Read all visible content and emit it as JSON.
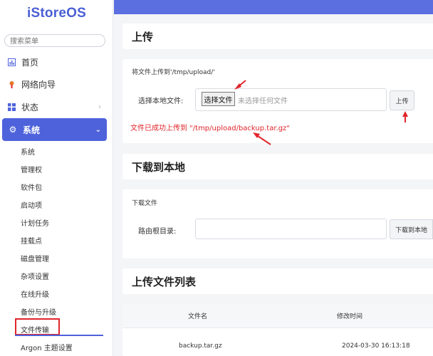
{
  "app": {
    "logo": "iStoreOS"
  },
  "sidebar": {
    "search_placeholder": "搜索菜单",
    "items": [
      {
        "label": "首页",
        "icon": "dashboard-icon"
      },
      {
        "label": "网络向导",
        "icon": "network-wizard-icon"
      },
      {
        "label": "状态",
        "icon": "status-icon"
      },
      {
        "label": "系统",
        "icon": "gear-icon"
      }
    ],
    "sub_items": [
      "系统",
      "管理权",
      "软件包",
      "启动项",
      "计划任务",
      "挂载点",
      "磁盘管理",
      "杂项设置",
      "在线升级",
      "备份与升级",
      "文件传输",
      "Argon 主题设置"
    ]
  },
  "upload": {
    "title": "上传",
    "hint": "将文件上传到'/tmp/upload/'",
    "field_label": "选择本地文件:",
    "choose_label": "选择文件",
    "no_file": "未选择任何文件",
    "upload_button": "上传",
    "success": "文件已成功上传到 \"/tmp/upload/backup.tar.gz\""
  },
  "download": {
    "title": "下载到本地",
    "section_label": "下载文件",
    "field_label": "路由根目录:",
    "input_value": "",
    "button": "下载到本地"
  },
  "file_list": {
    "title": "上传文件列表",
    "columns": [
      "文件名",
      "修改时间"
    ],
    "rows": [
      {
        "name": "backup.tar.gz",
        "mtime": "2024-03-30 16:13:18"
      }
    ]
  },
  "colors": {
    "accent": "#4e62db",
    "topbar": "#5c6fe0",
    "annotation": "#e0252a"
  }
}
